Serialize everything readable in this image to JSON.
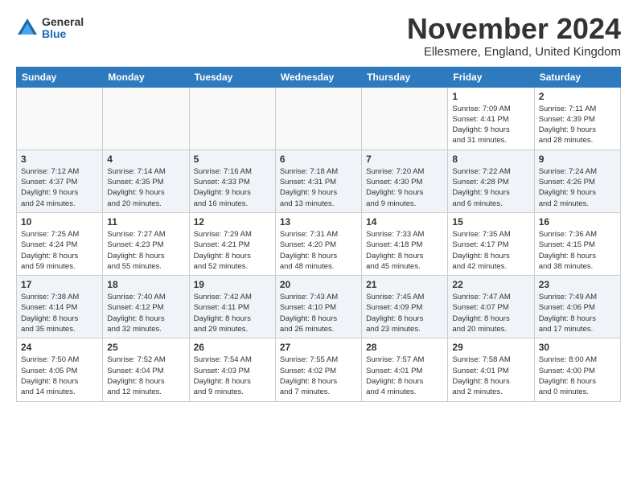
{
  "logo": {
    "general": "General",
    "blue": "Blue"
  },
  "title": "November 2024",
  "location": "Ellesmere, England, United Kingdom",
  "days_header": [
    "Sunday",
    "Monday",
    "Tuesday",
    "Wednesday",
    "Thursday",
    "Friday",
    "Saturday"
  ],
  "weeks": [
    [
      {
        "day": "",
        "info": ""
      },
      {
        "day": "",
        "info": ""
      },
      {
        "day": "",
        "info": ""
      },
      {
        "day": "",
        "info": ""
      },
      {
        "day": "",
        "info": ""
      },
      {
        "day": "1",
        "info": "Sunrise: 7:09 AM\nSunset: 4:41 PM\nDaylight: 9 hours\nand 31 minutes."
      },
      {
        "day": "2",
        "info": "Sunrise: 7:11 AM\nSunset: 4:39 PM\nDaylight: 9 hours\nand 28 minutes."
      }
    ],
    [
      {
        "day": "3",
        "info": "Sunrise: 7:12 AM\nSunset: 4:37 PM\nDaylight: 9 hours\nand 24 minutes."
      },
      {
        "day": "4",
        "info": "Sunrise: 7:14 AM\nSunset: 4:35 PM\nDaylight: 9 hours\nand 20 minutes."
      },
      {
        "day": "5",
        "info": "Sunrise: 7:16 AM\nSunset: 4:33 PM\nDaylight: 9 hours\nand 16 minutes."
      },
      {
        "day": "6",
        "info": "Sunrise: 7:18 AM\nSunset: 4:31 PM\nDaylight: 9 hours\nand 13 minutes."
      },
      {
        "day": "7",
        "info": "Sunrise: 7:20 AM\nSunset: 4:30 PM\nDaylight: 9 hours\nand 9 minutes."
      },
      {
        "day": "8",
        "info": "Sunrise: 7:22 AM\nSunset: 4:28 PM\nDaylight: 9 hours\nand 6 minutes."
      },
      {
        "day": "9",
        "info": "Sunrise: 7:24 AM\nSunset: 4:26 PM\nDaylight: 9 hours\nand 2 minutes."
      }
    ],
    [
      {
        "day": "10",
        "info": "Sunrise: 7:25 AM\nSunset: 4:24 PM\nDaylight: 8 hours\nand 59 minutes."
      },
      {
        "day": "11",
        "info": "Sunrise: 7:27 AM\nSunset: 4:23 PM\nDaylight: 8 hours\nand 55 minutes."
      },
      {
        "day": "12",
        "info": "Sunrise: 7:29 AM\nSunset: 4:21 PM\nDaylight: 8 hours\nand 52 minutes."
      },
      {
        "day": "13",
        "info": "Sunrise: 7:31 AM\nSunset: 4:20 PM\nDaylight: 8 hours\nand 48 minutes."
      },
      {
        "day": "14",
        "info": "Sunrise: 7:33 AM\nSunset: 4:18 PM\nDaylight: 8 hours\nand 45 minutes."
      },
      {
        "day": "15",
        "info": "Sunrise: 7:35 AM\nSunset: 4:17 PM\nDaylight: 8 hours\nand 42 minutes."
      },
      {
        "day": "16",
        "info": "Sunrise: 7:36 AM\nSunset: 4:15 PM\nDaylight: 8 hours\nand 38 minutes."
      }
    ],
    [
      {
        "day": "17",
        "info": "Sunrise: 7:38 AM\nSunset: 4:14 PM\nDaylight: 8 hours\nand 35 minutes."
      },
      {
        "day": "18",
        "info": "Sunrise: 7:40 AM\nSunset: 4:12 PM\nDaylight: 8 hours\nand 32 minutes."
      },
      {
        "day": "19",
        "info": "Sunrise: 7:42 AM\nSunset: 4:11 PM\nDaylight: 8 hours\nand 29 minutes."
      },
      {
        "day": "20",
        "info": "Sunrise: 7:43 AM\nSunset: 4:10 PM\nDaylight: 8 hours\nand 26 minutes."
      },
      {
        "day": "21",
        "info": "Sunrise: 7:45 AM\nSunset: 4:09 PM\nDaylight: 8 hours\nand 23 minutes."
      },
      {
        "day": "22",
        "info": "Sunrise: 7:47 AM\nSunset: 4:07 PM\nDaylight: 8 hours\nand 20 minutes."
      },
      {
        "day": "23",
        "info": "Sunrise: 7:49 AM\nSunset: 4:06 PM\nDaylight: 8 hours\nand 17 minutes."
      }
    ],
    [
      {
        "day": "24",
        "info": "Sunrise: 7:50 AM\nSunset: 4:05 PM\nDaylight: 8 hours\nand 14 minutes."
      },
      {
        "day": "25",
        "info": "Sunrise: 7:52 AM\nSunset: 4:04 PM\nDaylight: 8 hours\nand 12 minutes."
      },
      {
        "day": "26",
        "info": "Sunrise: 7:54 AM\nSunset: 4:03 PM\nDaylight: 8 hours\nand 9 minutes."
      },
      {
        "day": "27",
        "info": "Sunrise: 7:55 AM\nSunset: 4:02 PM\nDaylight: 8 hours\nand 7 minutes."
      },
      {
        "day": "28",
        "info": "Sunrise: 7:57 AM\nSunset: 4:01 PM\nDaylight: 8 hours\nand 4 minutes."
      },
      {
        "day": "29",
        "info": "Sunrise: 7:58 AM\nSunset: 4:01 PM\nDaylight: 8 hours\nand 2 minutes."
      },
      {
        "day": "30",
        "info": "Sunrise: 8:00 AM\nSunset: 4:00 PM\nDaylight: 8 hours\nand 0 minutes."
      }
    ]
  ]
}
